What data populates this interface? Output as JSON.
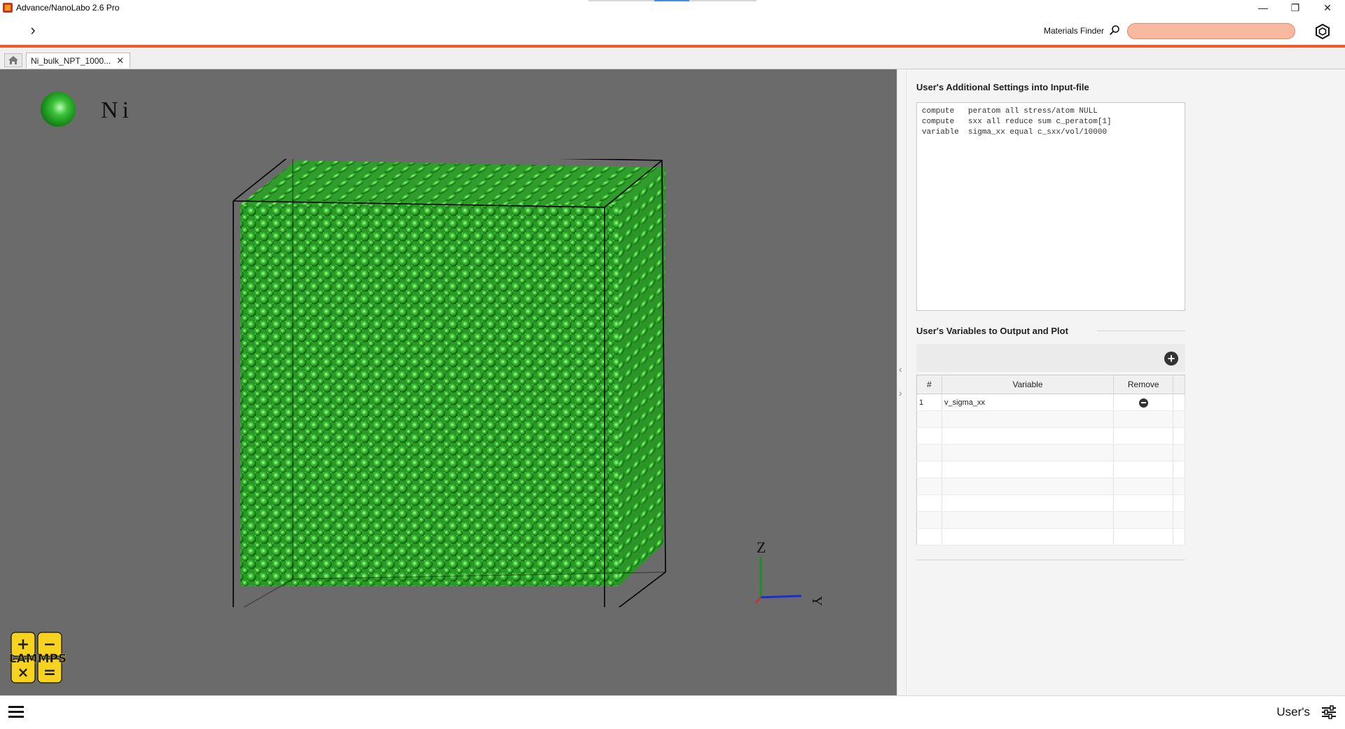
{
  "window": {
    "title": "Advance/NanoLabo 2.6 Pro",
    "minimize": "—",
    "restore": "❐",
    "close": "✕"
  },
  "toolbar": {
    "expand_glyph": "›",
    "materials_finder_label": "Materials Finder",
    "materials_finder_value": "",
    "icons": [
      "chevron-right-icon",
      "search-icon",
      "hexagon-icon"
    ]
  },
  "tabs": [
    {
      "label": "Ni_bulk_NPT_1000...",
      "close": "✕",
      "icon": "home-icon"
    }
  ],
  "viewer": {
    "element_symbol": "Ni",
    "atom_color": "#3cbf3a",
    "background": "#6b6b6b",
    "axes": {
      "z": "Z",
      "y": "Y"
    },
    "axis_colors": {
      "z": "#1f8f2a",
      "y": "#1a2fd0",
      "x": "#c0392b"
    },
    "logo_text": "LAMMPS",
    "logo_symbols": [
      "+",
      "−",
      "×",
      "="
    ]
  },
  "panel": {
    "settings_title": "User's Additional Settings into Input-file",
    "settings_lines": [
      "compute   peratom all stress/atom NULL",
      "compute   sxx all reduce sum c_peratom[1]",
      "variable  sigma_xx equal c_sxx/vol/10000"
    ],
    "variables_title": "User's Variables to Output and Plot",
    "table": {
      "headers": [
        "#",
        "Variable",
        "Remove"
      ],
      "rows": [
        {
          "index": "1",
          "variable": "v_sigma_xx"
        }
      ]
    }
  },
  "bottom": {
    "users_label": "User's",
    "icons": [
      "hamburger-menu-icon",
      "sliders-icon"
    ]
  }
}
